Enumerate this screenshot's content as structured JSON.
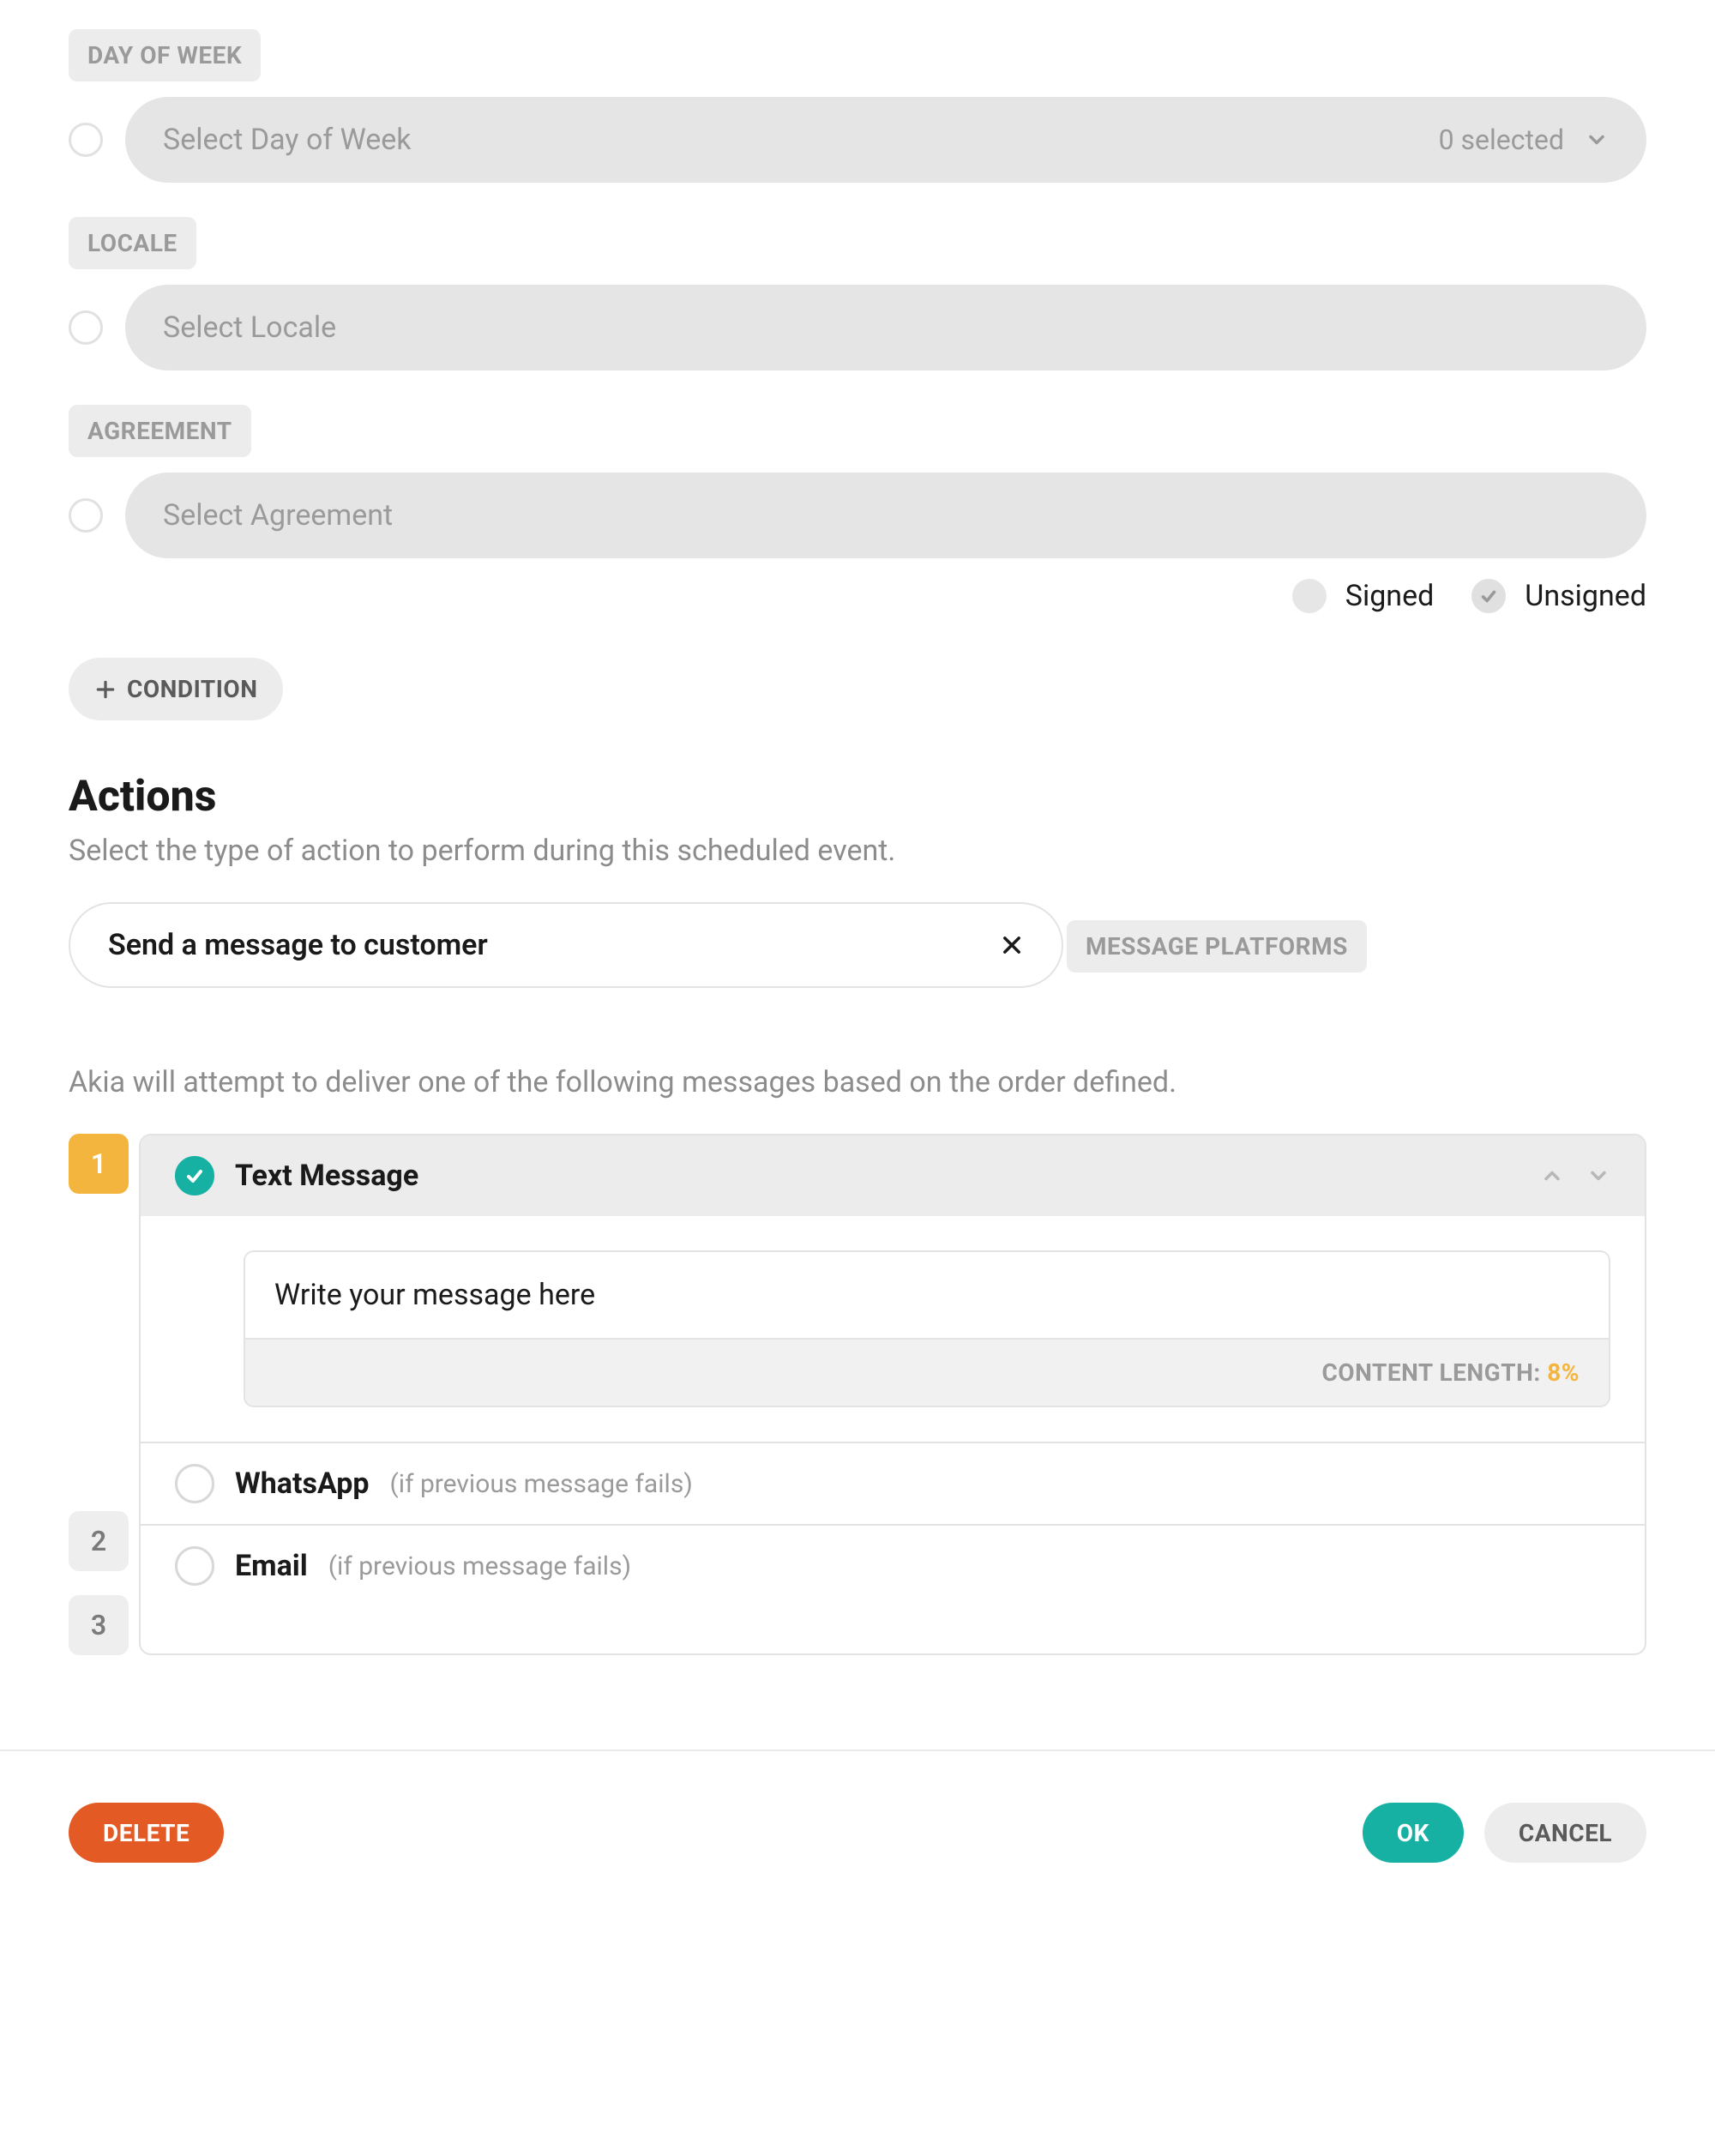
{
  "conditions": {
    "day_of_week": {
      "label": "DAY OF WEEK",
      "placeholder": "Select Day of Week",
      "selected_count_text": "0 selected"
    },
    "locale": {
      "label": "LOCALE",
      "placeholder": "Select Locale"
    },
    "agreement": {
      "label": "AGREEMENT",
      "placeholder": "Select Agreement",
      "signed_label": "Signed",
      "unsigned_label": "Unsigned",
      "signed_checked": false,
      "unsigned_checked": true
    },
    "add_condition_label": "CONDITION"
  },
  "actions": {
    "title": "Actions",
    "subtitle": "Select the type of action to perform during this scheduled event.",
    "selected_action": "Send a message to customer"
  },
  "message_platforms": {
    "label": "MESSAGE PLATFORMS",
    "description": "Akia will attempt to deliver one of the following messages based on the order defined.",
    "fallback_hint": "(if previous message fails)",
    "content_length_label": "CONTENT LENGTH:",
    "content_length_value": "8%",
    "platforms": [
      {
        "index": "1",
        "name": "Text Message",
        "enabled": true,
        "message": "Write your message here"
      },
      {
        "index": "2",
        "name": "WhatsApp",
        "enabled": false
      },
      {
        "index": "3",
        "name": "Email",
        "enabled": false
      }
    ]
  },
  "footer": {
    "delete": "DELETE",
    "ok": "OK",
    "cancel": "CANCEL"
  }
}
